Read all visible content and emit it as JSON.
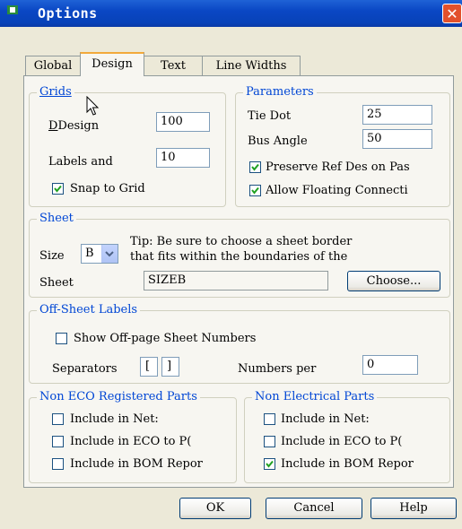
{
  "window": {
    "title": "Options",
    "close_glyph": "✕"
  },
  "tabs": [
    {
      "label": "Global",
      "active": false
    },
    {
      "label": "Design",
      "active": true
    },
    {
      "label": "Text",
      "active": false
    },
    {
      "label": "Line Widths",
      "active": false
    }
  ],
  "grids": {
    "legend": "Grids",
    "design_label": "Design",
    "design_value": "100",
    "labels_label": "Labels and",
    "labels_value": "10",
    "snap_label": "Snap to Grid",
    "snap_checked": true
  },
  "parameters": {
    "legend": "Parameters",
    "tie_dot_label": "Tie Dot",
    "tie_dot_value": "25",
    "bus_angle_label": "Bus Angle",
    "bus_angle_value": "50",
    "preserve_label": "Preserve Ref Des on Pas",
    "preserve_checked": true,
    "allow_label": "Allow Floating Connecti",
    "allow_checked": true
  },
  "sheet": {
    "legend": "Sheet",
    "size_label": "Size",
    "size_value": "B",
    "tip_line1": "Tip: Be sure to choose a sheet border",
    "tip_line2": "that fits within the boundaries of the",
    "sheet_label": "Sheet",
    "sheet_value": "SIZEB",
    "choose_label": "Choose..."
  },
  "offsheet": {
    "legend": "Off-Sheet Labels",
    "show_label": "Show Off-page Sheet Numbers",
    "show_checked": false,
    "separators_label": "Separators",
    "sep_open": "[",
    "sep_close": "]",
    "numbers_label": "Numbers per",
    "numbers_value": "0"
  },
  "non_eco": {
    "legend": "Non ECO Registered Parts",
    "items": [
      {
        "label": "Include in Net:",
        "checked": false
      },
      {
        "label": "Include in ECO to P(",
        "checked": false
      },
      {
        "label": "Include in BOM Repor",
        "checked": false
      }
    ]
  },
  "non_electrical": {
    "legend": "Non Electrical Parts",
    "items": [
      {
        "label": "Include in Net:",
        "checked": false
      },
      {
        "label": "Include in ECO to P(",
        "checked": false
      },
      {
        "label": "Include in BOM Repor",
        "checked": true
      }
    ]
  },
  "buttons": {
    "ok": "OK",
    "cancel": "Cancel",
    "help": "Help"
  }
}
